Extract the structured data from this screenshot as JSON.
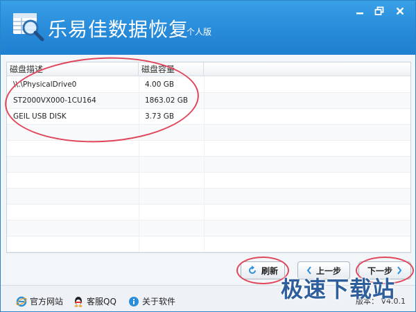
{
  "window": {
    "title": "乐易佳数据恢复",
    "edition": "个人版",
    "logo_icon": "magnifier-table-icon"
  },
  "table": {
    "columns": [
      "磁盘描述",
      "磁盘容量"
    ],
    "rows": [
      {
        "description": "\\\\.\\PhysicalDrive0",
        "capacity": "4.00 GB"
      },
      {
        "description": "ST2000VX000-1CU164",
        "capacity": "1863.02 GB"
      },
      {
        "description": "GEIL USB DISK",
        "capacity": "3.73 GB"
      }
    ]
  },
  "buttons": {
    "refresh": "刷新",
    "prev": "上一步",
    "next": "下一步"
  },
  "statusbar": {
    "website": "官方网站",
    "support_qq": "客服QQ",
    "about": "关于软件",
    "version": "版本： V4.0.1"
  },
  "watermark": "极速下载站",
  "colors": {
    "title_bar": "#2a8edc",
    "highlight": "#e0455a",
    "accent": "#1f7fd0"
  }
}
